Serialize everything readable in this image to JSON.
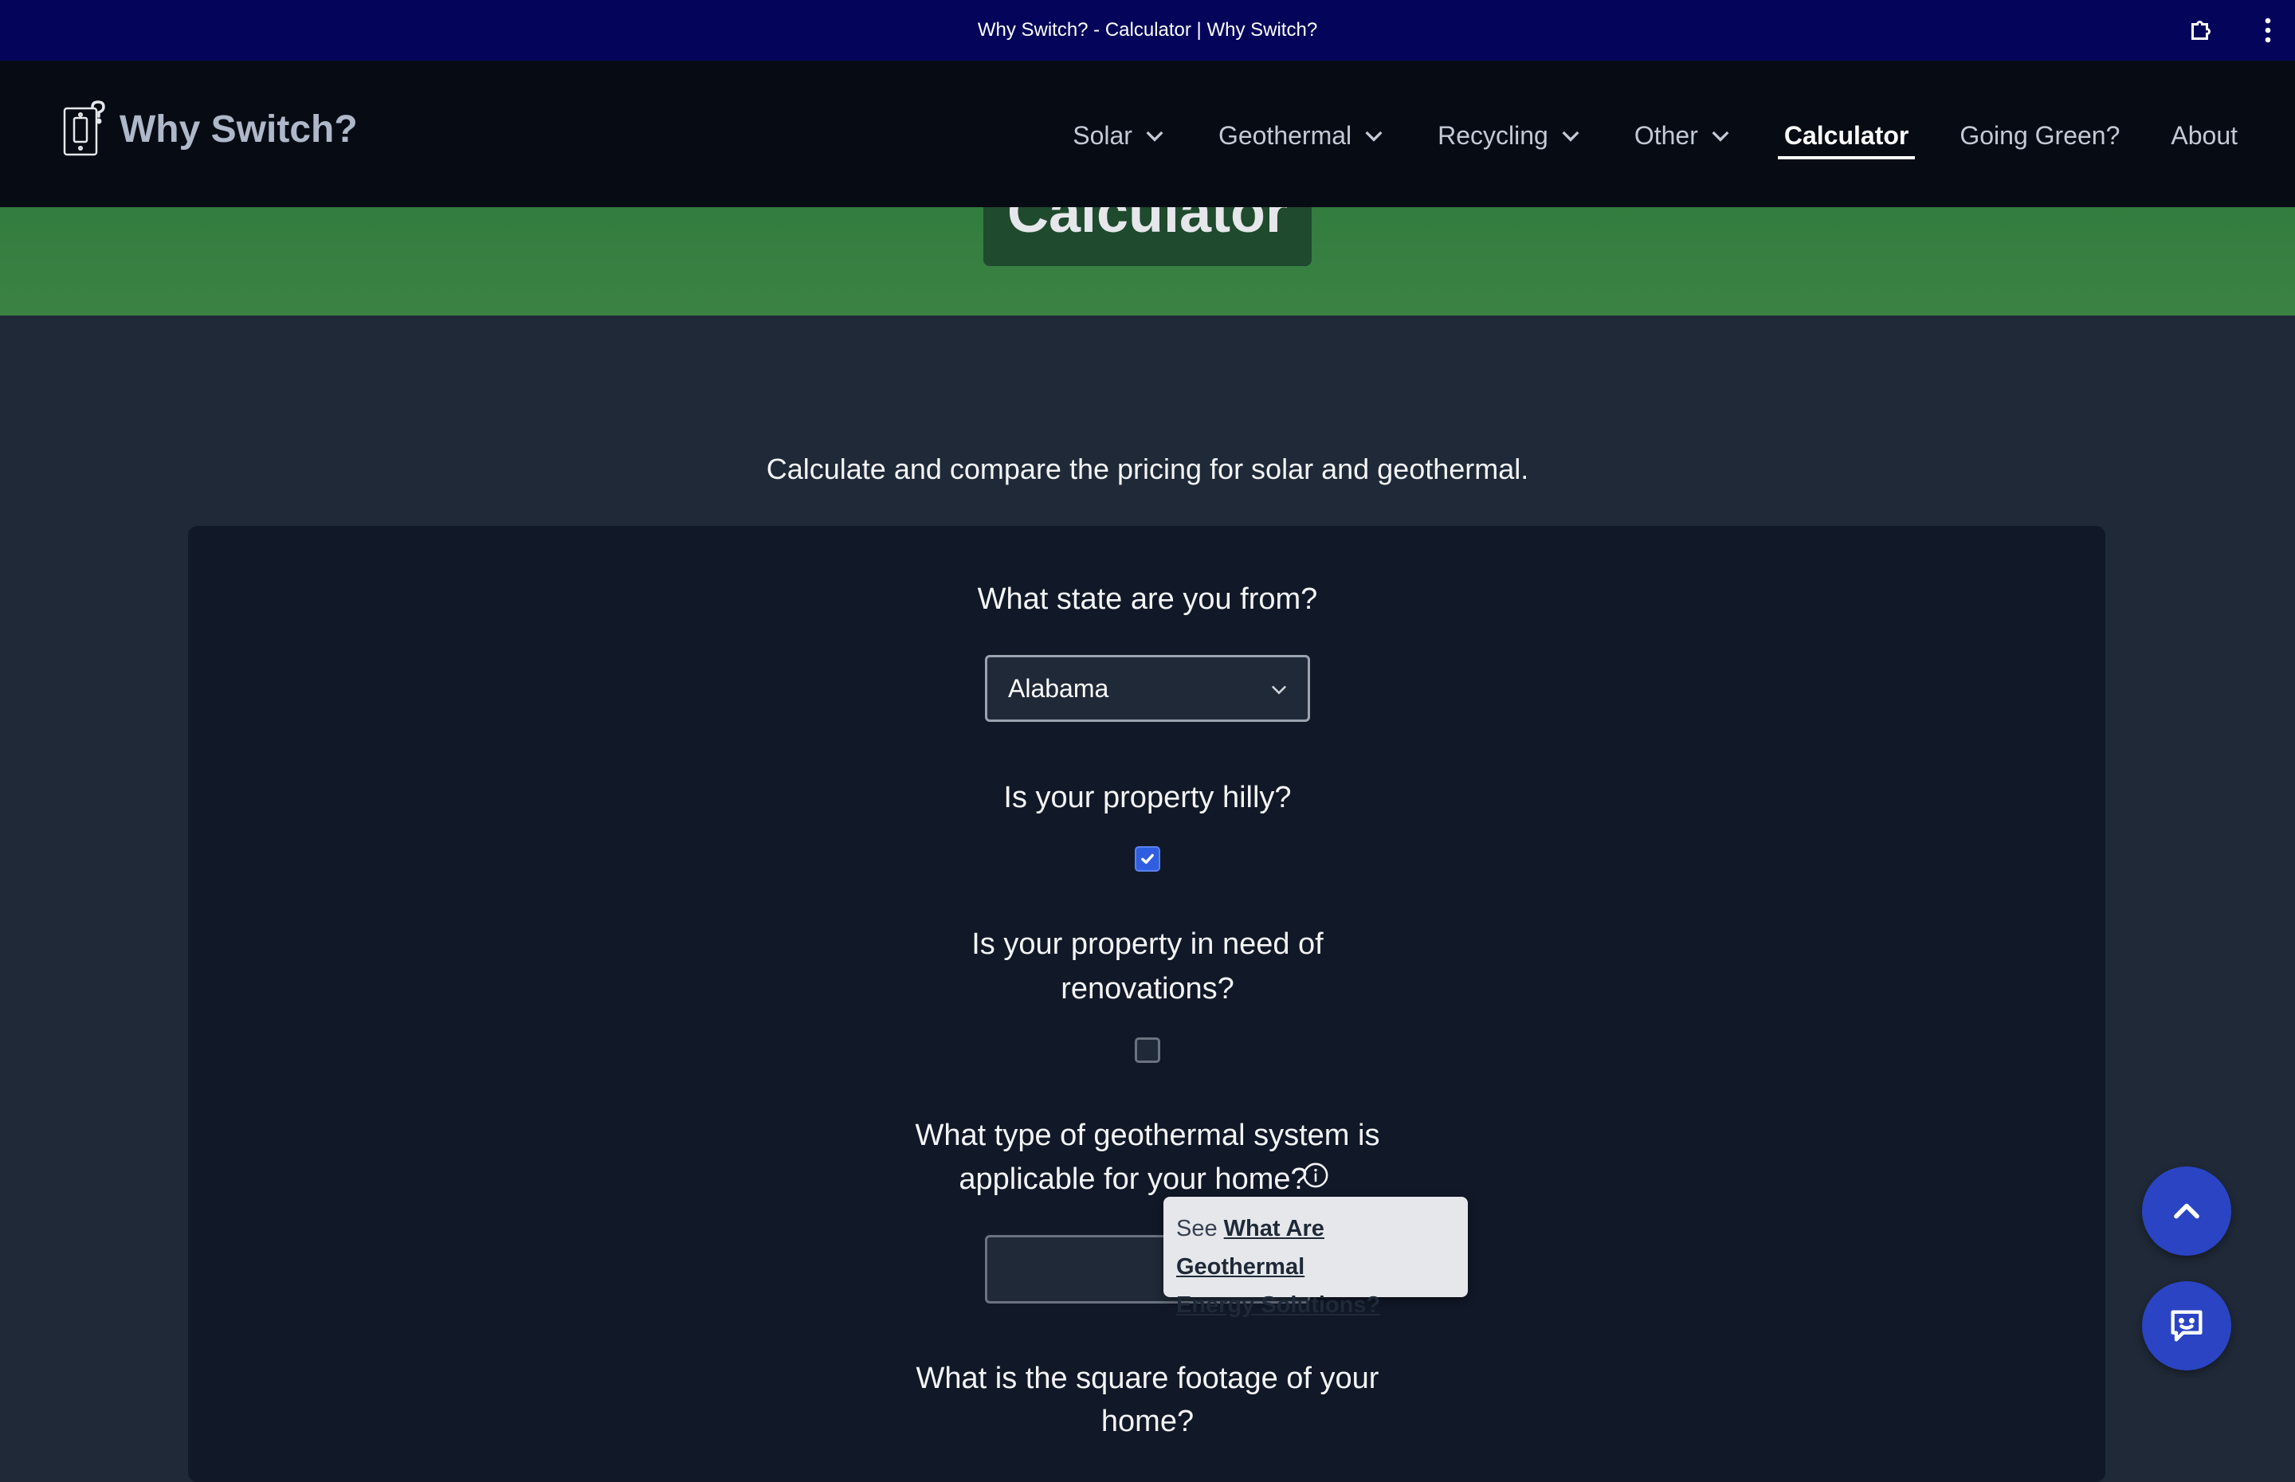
{
  "browser": {
    "title": "Why Switch? - Calculator | Why Switch?"
  },
  "header": {
    "brand": "Why Switch?",
    "nav": [
      {
        "label": "Solar",
        "dropdown": true,
        "active": false
      },
      {
        "label": "Geothermal",
        "dropdown": true,
        "active": false
      },
      {
        "label": "Recycling",
        "dropdown": true,
        "active": false
      },
      {
        "label": "Other",
        "dropdown": true,
        "active": false
      },
      {
        "label": "Calculator",
        "dropdown": false,
        "active": true
      },
      {
        "label": "Going Green?",
        "dropdown": false,
        "active": false
      },
      {
        "label": "About",
        "dropdown": false,
        "active": false
      }
    ]
  },
  "hero": {
    "title": "Calculator"
  },
  "main": {
    "intro": "Calculate and compare the pricing for solar and geothermal.",
    "state_question": "What state are you from?",
    "state_value": "Alabama",
    "hilly_question": "Is your property hilly?",
    "hilly_checked": true,
    "renovation_question_line1": "Is your property in need of",
    "renovation_question_line2": "renovations?",
    "renovation_checked": false,
    "system_question_line1": "What type of geothermal system is",
    "system_question_line2": "applicable for your home?",
    "system_value": "",
    "tooltip_prefix": "See ",
    "tooltip_link_line1": "What Are Geothermal",
    "tooltip_link_line2": "Energy Solutions?",
    "footage_question_line1": "What is the square footage of your",
    "footage_question_line2": "home?"
  },
  "colors": {
    "titlebar": "#04055a",
    "navbar": "#070b14",
    "hero_green": "#3b8244",
    "page_bg": "#1f2937",
    "card_bg": "#111827",
    "accent_blue": "#2a44c4"
  },
  "icons": {
    "brand": "light-switch-question-icon",
    "dropdown": "chevron-down-icon",
    "info": "info-circle-icon",
    "scroll_top": "chevron-up-icon",
    "chat": "chat-bubble-icon",
    "extension": "puzzle-extension-icon",
    "menu": "kebab-menu-icon"
  }
}
